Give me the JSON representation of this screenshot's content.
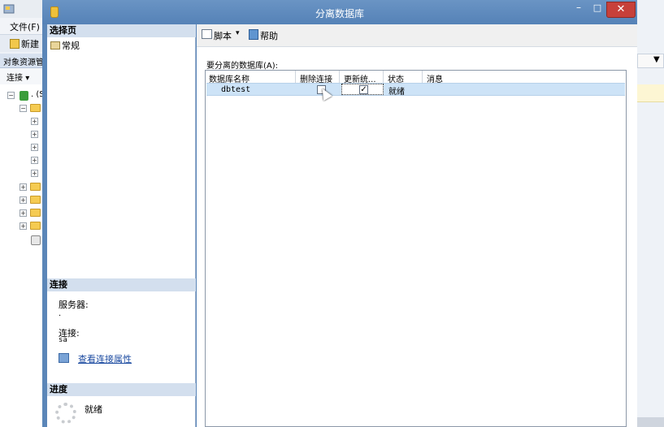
{
  "background_app": {
    "menu_file": "文件(F)",
    "new_query": "新建",
    "object_explorer_title": "对象资源管",
    "connect_label": "连接",
    "connect_dropdown": "▾",
    "server_node": ". (S"
  },
  "dialog": {
    "title": "分离数据库",
    "controls": {
      "minimize": "–",
      "maximize": "□",
      "close": "✕"
    },
    "left_panel": {
      "select_page_header": "选择页",
      "pages": [
        {
          "label": "常规",
          "icon": "page-icon"
        }
      ],
      "connection_header": "连接",
      "server_label": "服务器:",
      "server_value": ".",
      "connection_label": "连接:",
      "connection_value": "sa",
      "view_connection_properties": "查看连接属性",
      "progress_header": "进度",
      "progress_status": "就绪"
    },
    "toolbar": {
      "script_label": "脚本",
      "script_dropdown": "▾",
      "help_label": "帮助"
    },
    "databases_label": "要分离的数据库(A):",
    "grid": {
      "columns": [
        "数据库名称",
        "删除连接",
        "更新统...",
        "状态",
        "消息"
      ],
      "rows": [
        {
          "name": "dbtest",
          "drop_connections": false,
          "update_statistics": true,
          "update_check": "✓",
          "status": "就绪",
          "message": ""
        }
      ]
    },
    "accent_colors": {
      "title_bar": "#5b86b8",
      "close_button": "#c7403a",
      "selected_row": "#cde3f7"
    }
  }
}
